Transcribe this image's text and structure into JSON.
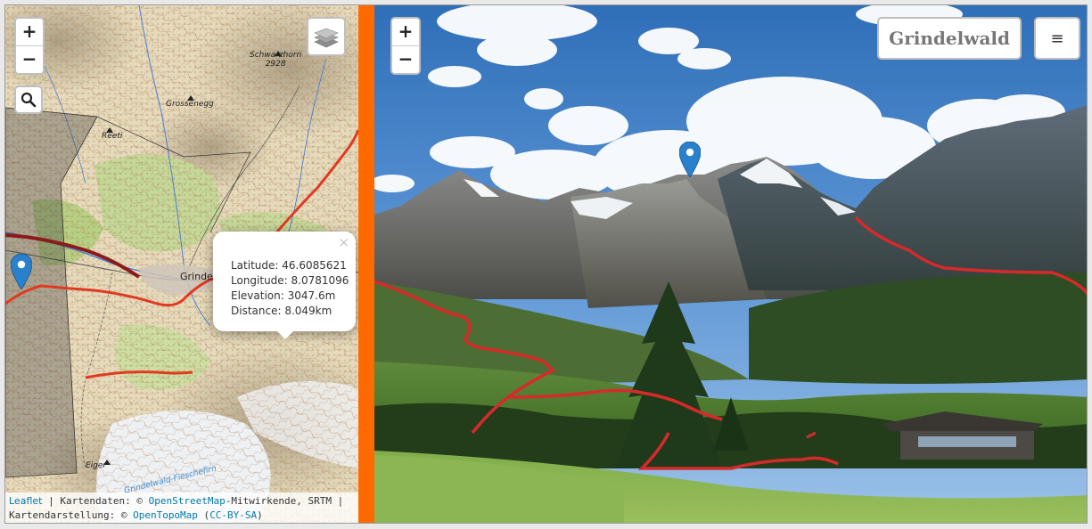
{
  "map": {
    "zoom_in_label": "+",
    "zoom_out_label": "−",
    "labels": {
      "schwarzhorn_name": "Schwarzhorn",
      "schwarzhorn_elev": "2928",
      "grossenegg": "Grossenegg",
      "reeti": "Reeti",
      "grindelwald": "Grindelwald",
      "eiger": "Eiger",
      "glacier": "Grindelwald-Fieschefirn"
    },
    "popup": {
      "close_label": "×",
      "latitude": "Latitude: 46.6085621",
      "longitude": "Longitude: 8.0781096",
      "elevation": "Elevation: 3047.6m",
      "distance": "Distance: 8.049km"
    },
    "attribution": {
      "leaflet": "Leaflet",
      "sep1": " | Kartendaten: © ",
      "osm": "OpenStreetMap",
      "contributors": "-Mitwirkende, SRTM |",
      "line2_prefix": "Kartendarstellung: © ",
      "opentopomap": "OpenTopoMap",
      "open_paren": " (",
      "license": "CC-BY-SA",
      "close_paren": ")"
    },
    "icons": {
      "search": "search-icon",
      "layers": "layers-icon",
      "marker": "map-marker-icon"
    }
  },
  "photo": {
    "zoom_in_label": "+",
    "zoom_out_label": "−",
    "title": "Grindelwald",
    "menu_icon": "≡"
  },
  "colors": {
    "divider": "#ff6a00",
    "route": "#d62a2a",
    "marker": "#2a81cb",
    "link": "#0078a8"
  }
}
